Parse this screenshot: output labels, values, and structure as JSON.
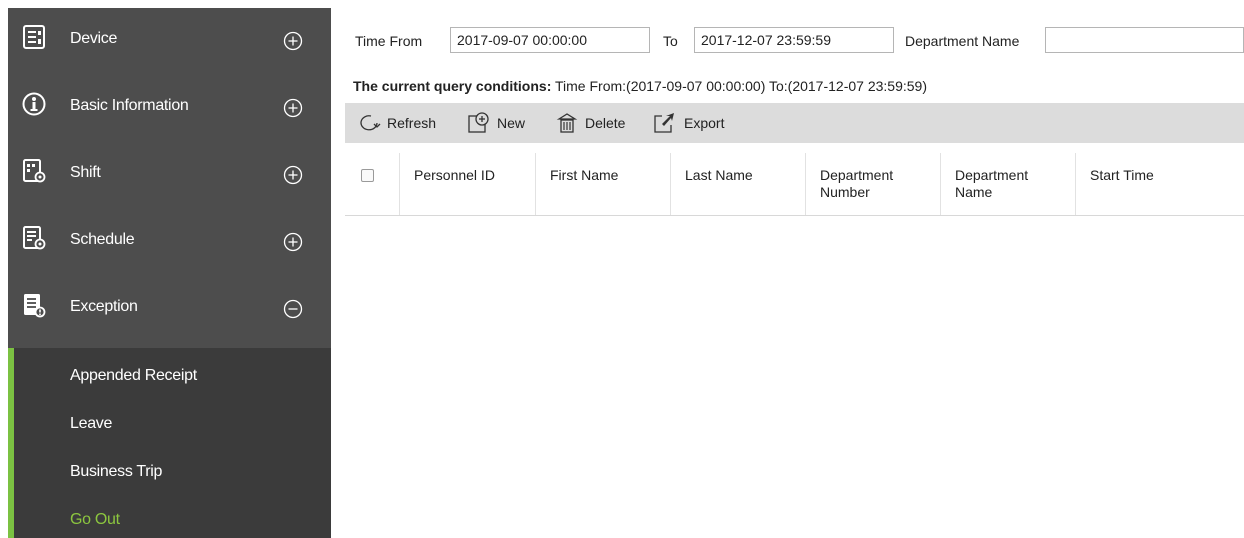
{
  "sidebar": {
    "menus": [
      {
        "label": "Device",
        "icon": "device-icon",
        "toggle": "expand-plus-icon"
      },
      {
        "label": "Basic Information",
        "icon": "info-icon",
        "toggle": "expand-plus-icon"
      },
      {
        "label": "Shift",
        "icon": "shift-icon",
        "toggle": "expand-plus-icon"
      },
      {
        "label": "Schedule",
        "icon": "schedule-icon",
        "toggle": "expand-plus-icon"
      },
      {
        "label": "Exception",
        "icon": "exception-icon",
        "toggle": "collapse-minus-icon"
      }
    ],
    "submenu": [
      {
        "label": "Appended Receipt"
      },
      {
        "label": "Leave"
      },
      {
        "label": "Business Trip"
      },
      {
        "label": "Go Out",
        "active": true
      }
    ],
    "colors": {
      "menu_bg": "#4d4d4d",
      "submenu_bg": "#3b3b3b",
      "accent": "#7bc142",
      "active_text": "#8cc63f"
    }
  },
  "filters": {
    "time_from_label": "Time From",
    "time_from_value": "2017-09-07 00:00:00",
    "to_label": "To",
    "to_value": "2017-12-07 23:59:59",
    "dept_name_label": "Department Name",
    "dept_name_value": ""
  },
  "conditions": {
    "prefix": "The current query conditions:",
    "text": " Time From:(2017-09-07 00:00:00)  To:(2017-12-07 23:59:59)"
  },
  "toolbar": {
    "refresh": "Refresh",
    "new": "New",
    "delete": "Delete",
    "export": "Export"
  },
  "table": {
    "columns": [
      "Personnel ID",
      "First Name",
      "Last Name",
      "Department Number",
      "Department Name",
      "Start Time"
    ],
    "rows": []
  }
}
